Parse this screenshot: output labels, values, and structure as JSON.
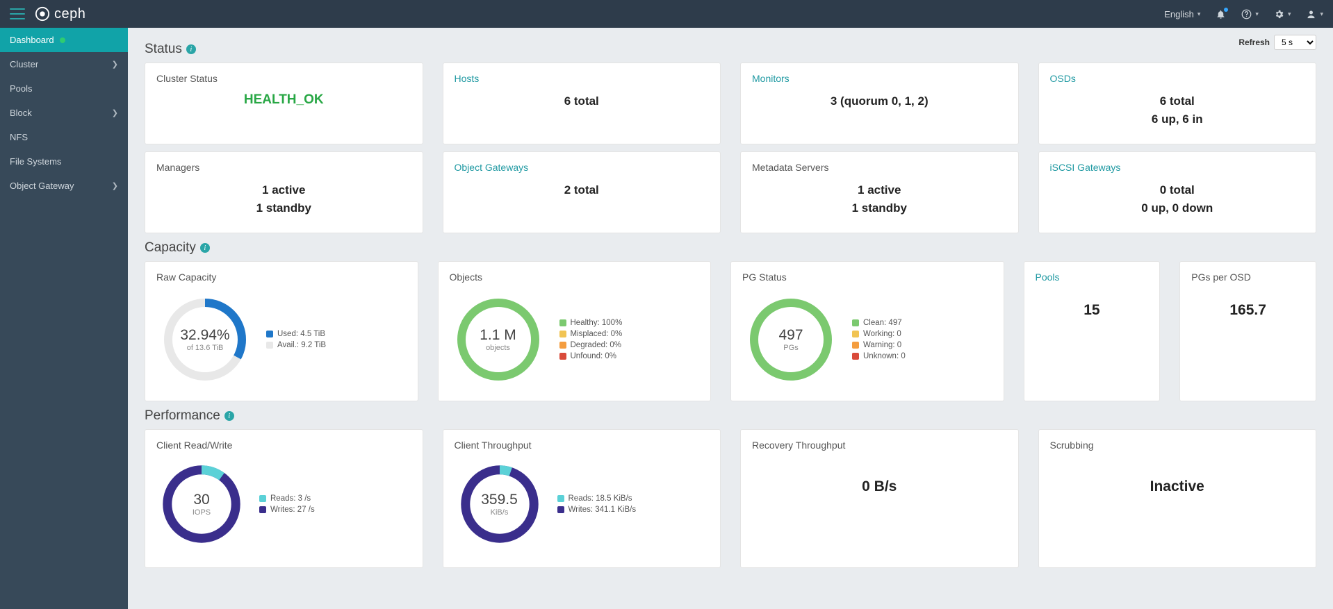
{
  "navbar": {
    "brand": "ceph",
    "language": "English"
  },
  "sidebar": {
    "items": [
      {
        "label": "Dashboard",
        "active": true,
        "health_dot": true
      },
      {
        "label": "Cluster",
        "expandable": true
      },
      {
        "label": "Pools"
      },
      {
        "label": "Block",
        "expandable": true
      },
      {
        "label": "NFS"
      },
      {
        "label": "File Systems"
      },
      {
        "label": "Object Gateway",
        "expandable": true
      }
    ]
  },
  "refresh": {
    "label": "Refresh",
    "selected": "5 s"
  },
  "sections": {
    "status": "Status",
    "capacity": "Capacity",
    "performance": "Performance"
  },
  "status": {
    "cluster_status": {
      "title": "Cluster Status",
      "value": "HEALTH_OK"
    },
    "hosts": {
      "title": "Hosts",
      "line1": "6 total"
    },
    "monitors": {
      "title": "Monitors",
      "line1": "3 (quorum 0, 1, 2)"
    },
    "osds": {
      "title": "OSDs",
      "line1": "6 total",
      "line2": "6 up, 6 in"
    },
    "managers": {
      "title": "Managers",
      "line1": "1 active",
      "line2": "1 standby"
    },
    "object_gw": {
      "title": "Object Gateways",
      "line1": "2 total"
    },
    "mds": {
      "title": "Metadata Servers",
      "line1": "1 active",
      "line2": "1 standby"
    },
    "iscsi": {
      "title": "iSCSI Gateways",
      "line1": "0 total",
      "line2": "0 up, 0 down"
    }
  },
  "capacity": {
    "raw": {
      "title": "Raw Capacity",
      "percent_label": "32.94%",
      "sub": "of 13.6 TiB",
      "legend": [
        {
          "label": "Used: 4.5 TiB",
          "color": "#1f77c9"
        },
        {
          "label": "Avail.: 9.2 TiB",
          "color": "#e8e8e8"
        }
      ],
      "used_frac": 0.3294
    },
    "objects": {
      "title": "Objects",
      "center": "1.1 M",
      "sub": "objects",
      "legend": [
        {
          "label": "Healthy: 100%",
          "color": "#7bc96f"
        },
        {
          "label": "Misplaced: 0%",
          "color": "#f1c453"
        },
        {
          "label": "Degraded: 0%",
          "color": "#f49d3f"
        },
        {
          "label": "Unfound: 0%",
          "color": "#d94a3a"
        }
      ]
    },
    "pg": {
      "title": "PG Status",
      "center": "497",
      "sub": "PGs",
      "legend": [
        {
          "label": "Clean: 497",
          "color": "#7bc96f"
        },
        {
          "label": "Working: 0",
          "color": "#f1c453"
        },
        {
          "label": "Warning: 0",
          "color": "#f49d3f"
        },
        {
          "label": "Unknown: 0",
          "color": "#d94a3a"
        }
      ]
    },
    "pools": {
      "title": "Pools",
      "value": "15"
    },
    "pgs_per_osd": {
      "title": "PGs per OSD",
      "value": "165.7"
    }
  },
  "performance": {
    "rw": {
      "title": "Client Read/Write",
      "center": "30",
      "sub": "IOPS",
      "reads_frac": 0.1,
      "legend": [
        {
          "label": "Reads: 3 /s",
          "color": "#5bd1d7"
        },
        {
          "label": "Writes: 27 /s",
          "color": "#3a2e8c"
        }
      ]
    },
    "throughput": {
      "title": "Client Throughput",
      "center": "359.5",
      "sub": "KiB/s",
      "reads_frac": 0.052,
      "legend": [
        {
          "label": "Reads: 18.5 KiB/s",
          "color": "#5bd1d7"
        },
        {
          "label": "Writes: 341.1 KiB/s",
          "color": "#3a2e8c"
        }
      ]
    },
    "recovery": {
      "title": "Recovery Throughput",
      "value": "0 B/s"
    },
    "scrubbing": {
      "title": "Scrubbing",
      "value": "Inactive"
    }
  },
  "chart_data": [
    {
      "type": "pie",
      "title": "Raw Capacity",
      "series": [
        {
          "name": "Used",
          "value": 4.5,
          "unit": "TiB"
        },
        {
          "name": "Avail.",
          "value": 9.2,
          "unit": "TiB"
        }
      ],
      "total_label": "13.6 TiB",
      "used_percent": 32.94
    },
    {
      "type": "pie",
      "title": "Objects",
      "unit": "%",
      "series": [
        {
          "name": "Healthy",
          "value": 100
        },
        {
          "name": "Misplaced",
          "value": 0
        },
        {
          "name": "Degraded",
          "value": 0
        },
        {
          "name": "Unfound",
          "value": 0
        }
      ],
      "total_label": "1.1 M objects"
    },
    {
      "type": "pie",
      "title": "PG Status",
      "unit": "PGs",
      "series": [
        {
          "name": "Clean",
          "value": 497
        },
        {
          "name": "Working",
          "value": 0
        },
        {
          "name": "Warning",
          "value": 0
        },
        {
          "name": "Unknown",
          "value": 0
        }
      ],
      "total_label": "497 PGs"
    },
    {
      "type": "pie",
      "title": "Client Read/Write",
      "unit": "/s",
      "series": [
        {
          "name": "Reads",
          "value": 3
        },
        {
          "name": "Writes",
          "value": 27
        }
      ],
      "total_label": "30 IOPS"
    },
    {
      "type": "pie",
      "title": "Client Throughput",
      "unit": "KiB/s",
      "series": [
        {
          "name": "Reads",
          "value": 18.5
        },
        {
          "name": "Writes",
          "value": 341.1
        }
      ],
      "total_label": "359.5 KiB/s"
    }
  ]
}
